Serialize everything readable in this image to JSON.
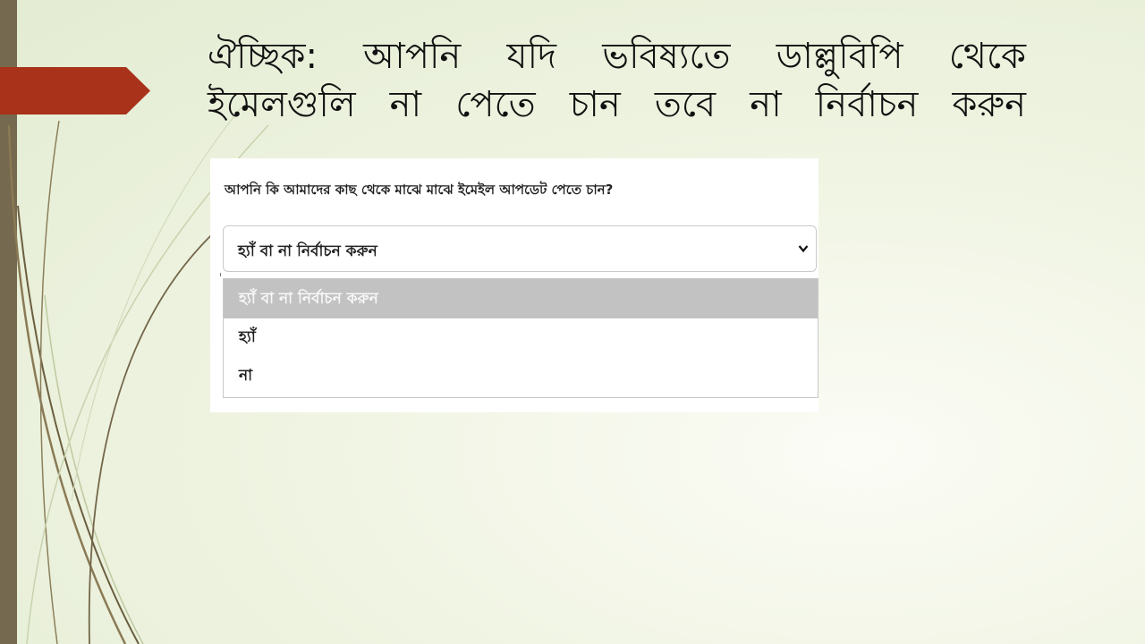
{
  "slide": {
    "title": "ঐচ্ছিক: আপনি যদি ভবিষ্যতে ডাল্লুবিপি থেকে ইমেলগুলি না পেতে চান তবে না নির্বাচন করুন"
  },
  "form": {
    "question": "আপনি কি আমাদের কাছ থেকে মাঝে মাঝে ইমেইল আপডেট পেতে চান?",
    "select_value": "হ্যাঁ বা না নির্বাচন করুন",
    "options": [
      {
        "label": "হ্যাঁ বা না নির্বাচন করুন",
        "highlighted": true
      },
      {
        "label": "হ্যাঁ",
        "highlighted": false
      },
      {
        "label": "না",
        "highlighted": false
      }
    ]
  },
  "colors": {
    "side_bar": "#75694f",
    "accent_tab": "#a8321a",
    "highlight_option": "#c2c2c2"
  }
}
